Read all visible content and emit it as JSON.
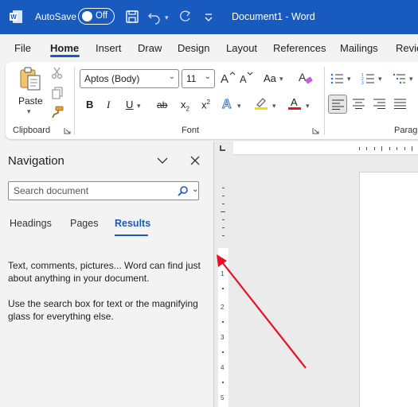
{
  "titlebar": {
    "autosave_label": "AutoSave",
    "toggle_state": "Off",
    "document_title": "Document1  -  Word"
  },
  "ribbon_tabs": [
    "File",
    "Home",
    "Insert",
    "Draw",
    "Design",
    "Layout",
    "References",
    "Mailings",
    "Revie"
  ],
  "active_tab": "Home",
  "ribbon": {
    "clipboard": {
      "paste_label": "Paste",
      "group_label": "Clipboard"
    },
    "font": {
      "font_name": "Aptos (Body)",
      "font_size": "11",
      "change_case": "Aa",
      "bold": "B",
      "italic": "I",
      "underline": "U",
      "strikethrough": "ab",
      "subscript": "x",
      "subscript_mark": "2",
      "superscript": "x",
      "superscript_mark": "2",
      "font_color_letter": "A",
      "group_label": "Font"
    },
    "paragraph": {
      "group_label": "Parag"
    }
  },
  "navigation": {
    "title": "Navigation",
    "search_placeholder": "Search document",
    "tabs": [
      "Headings",
      "Pages",
      "Results"
    ],
    "active_tab": "Results",
    "message_1": "Text, comments, pictures... Word can find just about anything in your document.",
    "message_2": "Use the search box for text or the magnifying glass for everything else."
  },
  "ruler": {
    "numbers": [
      "1",
      "2",
      "3",
      "4",
      "5"
    ]
  },
  "colors": {
    "titlebar": "#185abd",
    "accent": "#185abd",
    "highlight": "#ffd800",
    "font_color": "#e81123",
    "arrow": "#e81123"
  }
}
